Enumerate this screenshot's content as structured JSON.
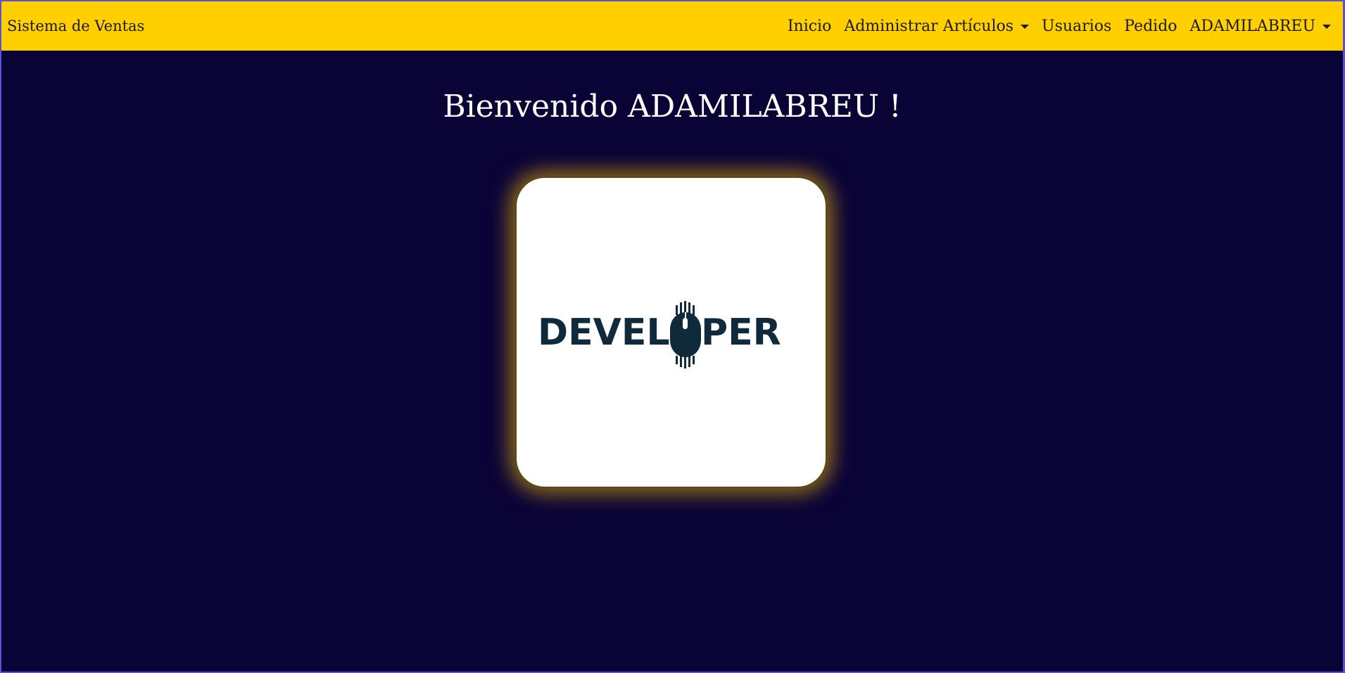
{
  "navbar": {
    "brand": "Sistema de Ventas",
    "items": [
      {
        "label": "Inicio",
        "dropdown": false
      },
      {
        "label": "Administrar Artículos",
        "dropdown": true
      },
      {
        "label": "Usuarios",
        "dropdown": false
      },
      {
        "label": "Pedido",
        "dropdown": false
      },
      {
        "label": "ADAMILABREU",
        "dropdown": true
      }
    ],
    "background": "#ffcf00"
  },
  "main": {
    "welcome": "Bienvenido ADAMILABREU !",
    "logo": {
      "text": "DEVELOPER",
      "icon": "computer-mouse-icon",
      "color": "#0f2a3a"
    },
    "background": "#0a0336"
  }
}
